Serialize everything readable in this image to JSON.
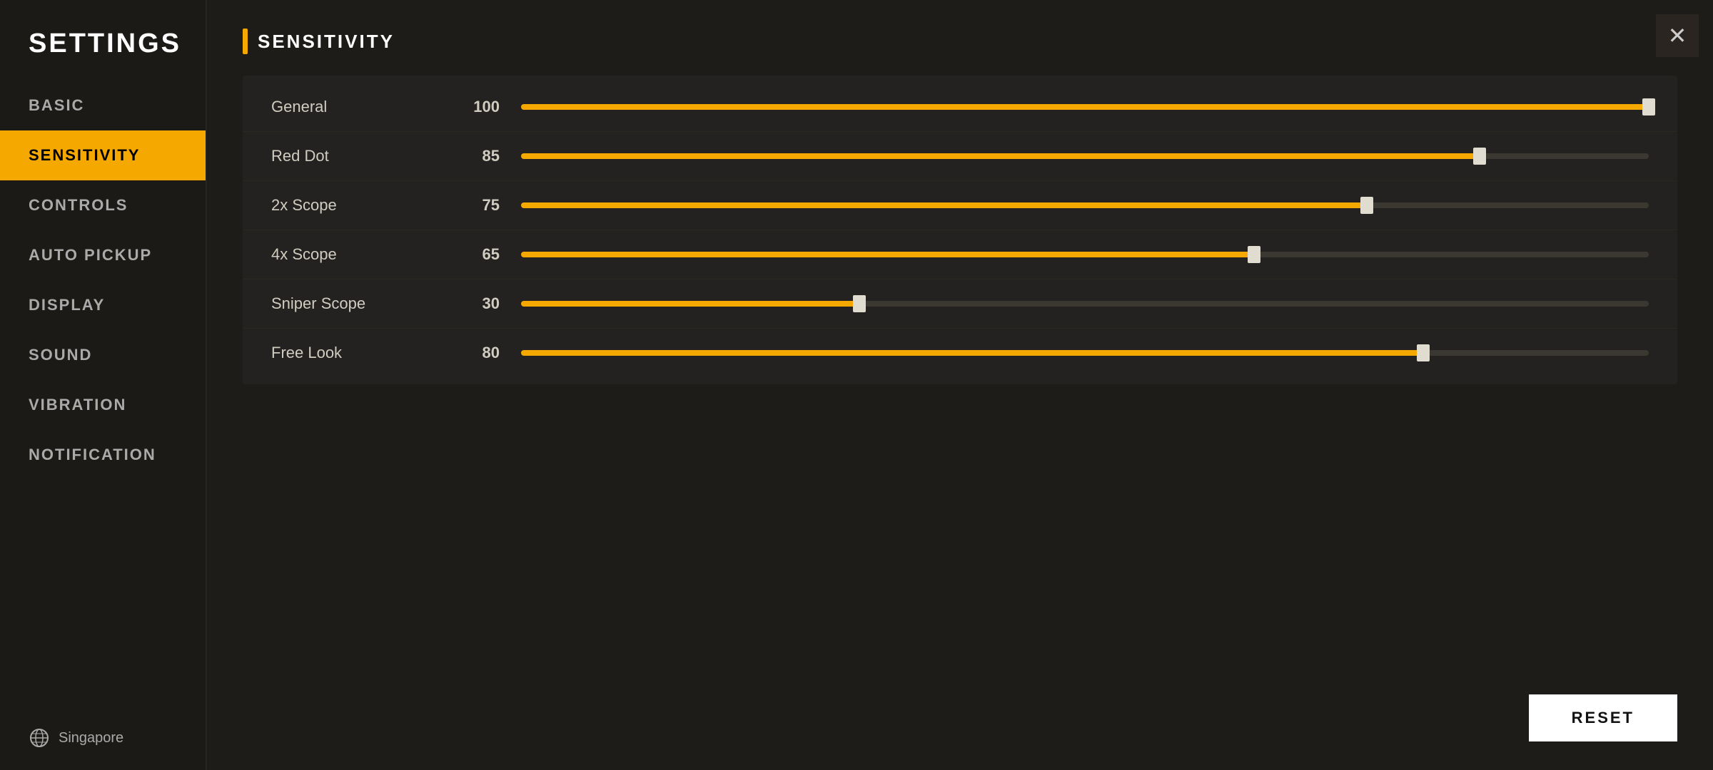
{
  "sidebar": {
    "title": "SETTINGS",
    "items": [
      {
        "id": "basic",
        "label": "BASIC",
        "active": false
      },
      {
        "id": "sensitivity",
        "label": "SENSITIVITY",
        "active": true
      },
      {
        "id": "controls",
        "label": "CONTROLS",
        "active": false
      },
      {
        "id": "auto-pickup",
        "label": "AUTO PICKUP",
        "active": false
      },
      {
        "id": "display",
        "label": "DISPLAY",
        "active": false
      },
      {
        "id": "sound",
        "label": "SOUND",
        "active": false
      },
      {
        "id": "vibration",
        "label": "VIBRATION",
        "active": false
      },
      {
        "id": "notification",
        "label": "NOTIFICATION",
        "active": false
      }
    ],
    "footer": {
      "location": "Singapore"
    }
  },
  "main": {
    "section_title": "SENSITIVITY",
    "sliders": [
      {
        "id": "general",
        "label": "General",
        "value": 100,
        "percent": 100
      },
      {
        "id": "red-dot",
        "label": "Red Dot",
        "value": 85,
        "percent": 85
      },
      {
        "id": "2x-scope",
        "label": "2x Scope",
        "value": 75,
        "percent": 75
      },
      {
        "id": "4x-scope",
        "label": "4x Scope",
        "value": 65,
        "percent": 65
      },
      {
        "id": "sniper-scope",
        "label": "Sniper Scope",
        "value": 30,
        "percent": 30
      },
      {
        "id": "free-look",
        "label": "Free Look",
        "value": 80,
        "percent": 80
      }
    ],
    "reset_label": "RESET"
  },
  "close_button_label": "✕",
  "colors": {
    "accent": "#f5a800",
    "sidebar_bg": "#1c1a17",
    "main_bg": "#1e1c18"
  }
}
